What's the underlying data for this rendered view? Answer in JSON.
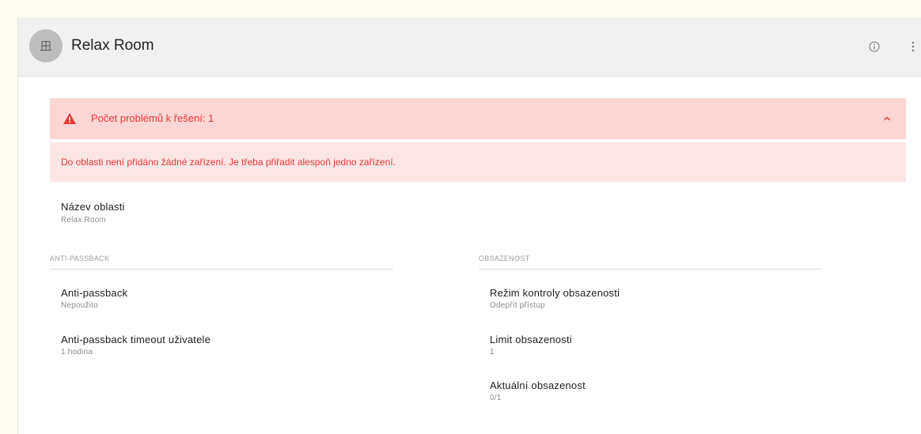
{
  "header": {
    "title": "Relax Room",
    "avatar_icon": "area-icon",
    "info_icon": "info-icon",
    "more_icon": "more-vertical-icon"
  },
  "alert": {
    "title": "Počet problémů k řešení: 1",
    "message": "Do oblasti není přidáno žádné zařízení. Je třeba přiřadit alespoň jedno zařízení.",
    "icon": "warning-icon",
    "toggle_icon": "chevron-up-icon",
    "color": "#e53935",
    "head_bg": "#fcd6d4",
    "body_bg": "#fce6e5"
  },
  "area_name": {
    "label": "Název oblasti",
    "value": "Relax Room"
  },
  "anti_passback": {
    "section_title": "ANTI-PASSBACK",
    "mode": {
      "label": "Anti-passback",
      "value": "Nepoužito"
    },
    "timeout": {
      "label": "Anti-passback timeout uživatele",
      "value": "1 hodina"
    }
  },
  "occupancy": {
    "section_title": "OBSAZENOST",
    "mode": {
      "label": "Režim kontroly obsazenosti",
      "value": "Odepřít přístup"
    },
    "limit": {
      "label": "Limit obsazenosti",
      "value": "1"
    },
    "current": {
      "label": "Aktuální obsazenost",
      "value": "0/1"
    }
  }
}
